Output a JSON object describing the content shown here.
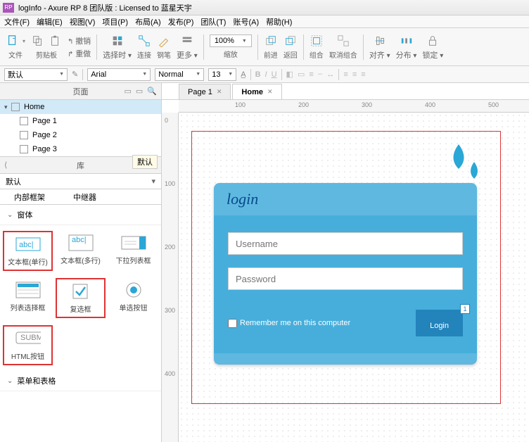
{
  "title": "logInfo - Axure RP 8 团队版 : Licensed to 蓝星天宇",
  "rp_badge": "RP",
  "menu": [
    "文件(F)",
    "编辑(E)",
    "视图(V)",
    "项目(P)",
    "布局(A)",
    "发布(P)",
    "团队(T)",
    "账号(A)",
    "帮助(H)"
  ],
  "toolbar": {
    "file_label": "文件",
    "clipboard_label": "剪贴板",
    "undo_label": "撤销",
    "redo_label": "重做",
    "selmode": "选择时",
    "connect": "连接",
    "pen": "钢笔",
    "more": "更多",
    "zoom": "100%",
    "zoom_label": "缩放",
    "front": "前进",
    "back": "返回",
    "group": "组合",
    "ungroup": "取消组合",
    "align": "对齐",
    "distribute": "分布",
    "lock": "锁定"
  },
  "format": {
    "style": "默认",
    "font": "Arial",
    "weight": "Normal",
    "size": "13"
  },
  "pages_panel_title": "页面",
  "tree": {
    "root": "Home",
    "items": [
      "Page 1",
      "Page 2",
      "Page 3"
    ]
  },
  "lib_panel_title": "库",
  "lib_default": "默认",
  "lib_tabs": [
    "内部框架",
    "中继器"
  ],
  "tooltip": "默认",
  "section_form": "窗体",
  "widgets_form": [
    {
      "label": "文本框(单行)"
    },
    {
      "label": "文本框(多行)"
    },
    {
      "label": "下拉列表框"
    },
    {
      "label": "列表选择框"
    },
    {
      "label": "复选框"
    },
    {
      "label": "单选按钮"
    },
    {
      "label": "HTML按钮"
    }
  ],
  "section_tables": "菜单和表格",
  "ws_tabs": [
    {
      "label": "Page 1"
    },
    {
      "label": "Home",
      "active": true
    }
  ],
  "ruler_h": [
    "100",
    "200",
    "300",
    "400",
    "500"
  ],
  "ruler_v": [
    "0",
    "100",
    "200",
    "300",
    "400"
  ],
  "login": {
    "title": "login",
    "username_ph": "Username",
    "password_ph": "Password",
    "remember": "Remember me on this computer",
    "button": "Login",
    "badge": "1"
  }
}
